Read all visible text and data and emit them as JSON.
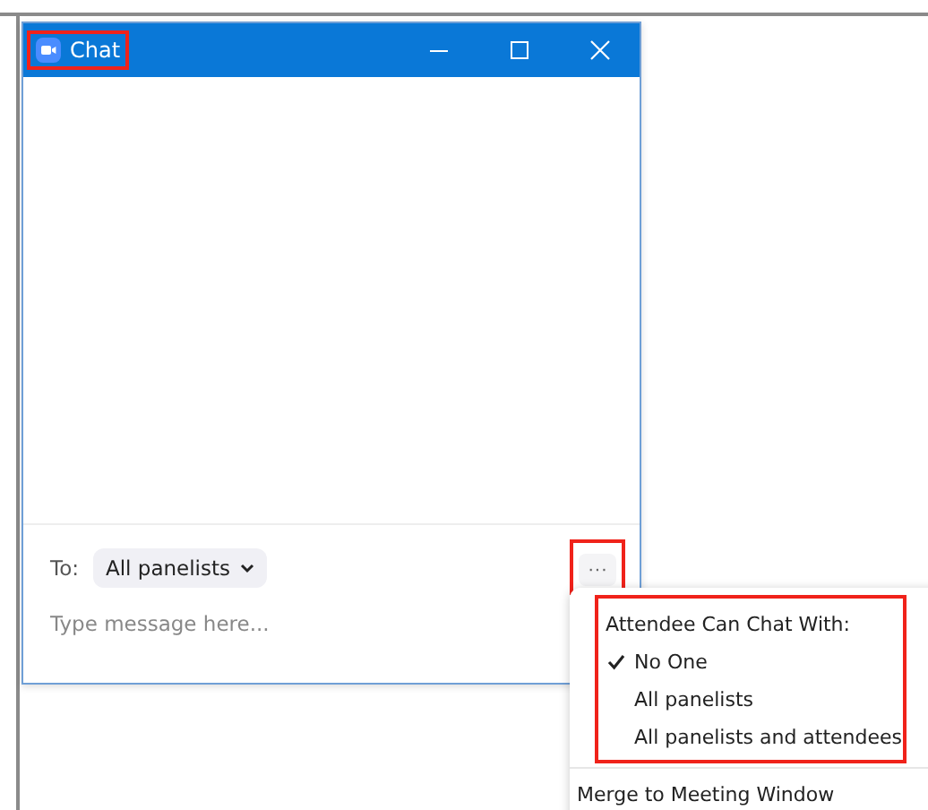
{
  "window": {
    "title": "Chat",
    "title_highlighted": true
  },
  "composer": {
    "to_label": "To:",
    "recipient": "All panelists",
    "placeholder": "Type message here...",
    "more_button": {
      "label": "···",
      "highlighted": true
    }
  },
  "menu": {
    "section_title": "Attendee Can Chat With:",
    "section_highlighted": true,
    "options": [
      {
        "label": "No One",
        "selected": true
      },
      {
        "label": "All panelists",
        "selected": false
      },
      {
        "label": "All panelists and attendees",
        "selected": false
      }
    ],
    "actions": [
      "Merge to Meeting Window"
    ]
  }
}
